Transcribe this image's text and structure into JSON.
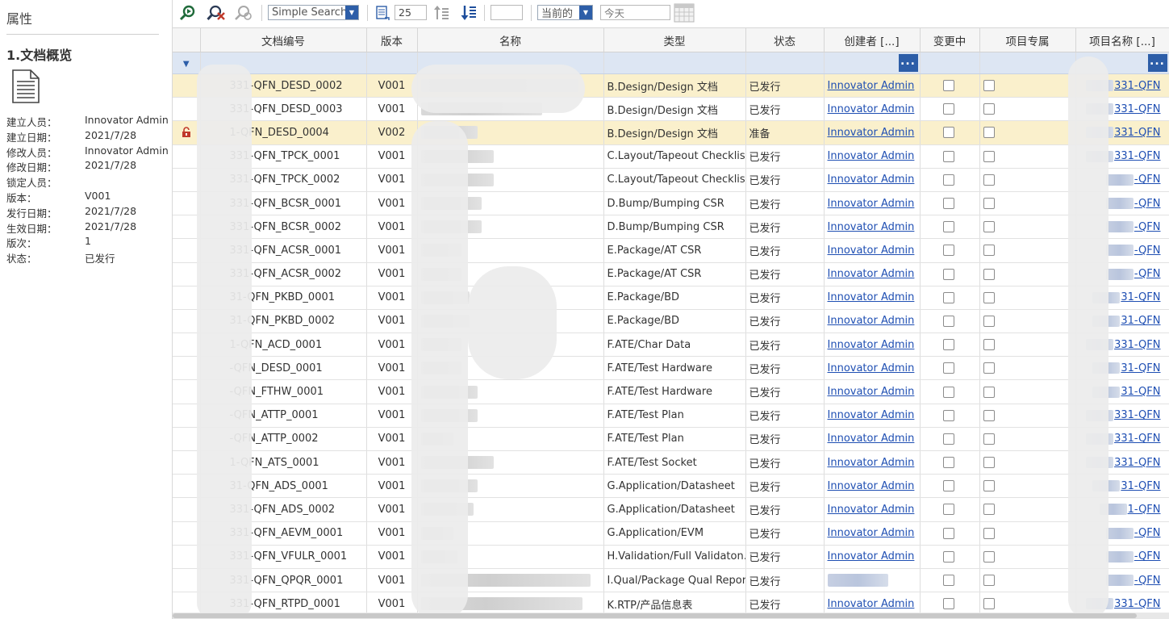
{
  "left_panel": {
    "title": "属性",
    "section_title": "1.文档概览",
    "doc_icon": "document-icon",
    "properties": [
      {
        "label": "建立人员：",
        "value": "Innovator Admin"
      },
      {
        "label": "建立日期：",
        "value": "2021/7/28"
      },
      {
        "label": "修改人员：",
        "value": "Innovator Admin"
      },
      {
        "label": "修改日期：",
        "value": "2021/7/28"
      },
      {
        "label": "锁定人员：",
        "value": ""
      },
      {
        "label": "版本：",
        "value": "V001"
      },
      {
        "label": "发行日期：",
        "value": "2021/7/28"
      },
      {
        "label": "生效日期：",
        "value": "2021/7/28"
      },
      {
        "label": "版次：",
        "value": "1"
      },
      {
        "label": "状态：",
        "value": "已发行"
      }
    ]
  },
  "toolbar": {
    "search_type": "Simple Search",
    "page_size": "25",
    "blank_input": "",
    "version_filter": "当前的",
    "date_input": "今天",
    "icons": [
      "run-search-icon",
      "clear-search-icon",
      "saved-search-icon",
      "page-size-icon",
      "sort-ascending-icon",
      "sort-descending-icon",
      "calendar-grid-icon"
    ]
  },
  "columns": [
    "",
    "文档编号",
    "版本",
    "名称",
    "类型",
    "状态",
    "创建者 [...]",
    "变更中",
    "项目专属",
    "项目名称 [...]"
  ],
  "filter_row": {
    "expand_icon": "expand-arrow-icon",
    "ellipsis": "..."
  },
  "rows": [
    {
      "num": "331-QFN_DESD_0002",
      "ver": "V001",
      "type": "B.Design/Design 文档",
      "status": "已发行",
      "creator": "Innovator Admin",
      "project": "331-QFN",
      "highlight": true,
      "locked": false
    },
    {
      "num": "331-QFN_DESD_0003",
      "ver": "V001",
      "type": "B.Design/Design 文档",
      "status": "已发行",
      "creator": "Innovator Admin",
      "project": "331-QFN",
      "highlight": false,
      "locked": false
    },
    {
      "num": "1-QFN_DESD_0004",
      "ver": "V002",
      "type": "B.Design/Design 文档",
      "status": "准备",
      "creator": "Innovator Admin",
      "project": "331-QFN",
      "highlight": true,
      "locked": true
    },
    {
      "num": "331-QFN_TPCK_0001",
      "ver": "V001",
      "type": "C.Layout/Tapeout Checklist",
      "status": "已发行",
      "creator": "Innovator Admin",
      "project": "331-QFN",
      "highlight": false,
      "locked": false
    },
    {
      "num": "331-QFN_TPCK_0002",
      "ver": "V001",
      "type": "C.Layout/Tapeout Checklist",
      "status": "已发行",
      "creator": "Innovator Admin",
      "project": "-QFN",
      "highlight": false,
      "locked": false
    },
    {
      "num": "331-QFN_BCSR_0001",
      "ver": "V001",
      "type": "D.Bump/Bumping CSR",
      "status": "已发行",
      "creator": "Innovator Admin",
      "project": "-QFN",
      "highlight": false,
      "locked": false
    },
    {
      "num": "331-QFN_BCSR_0002",
      "ver": "V001",
      "type": "D.Bump/Bumping CSR",
      "status": "已发行",
      "creator": "Innovator Admin",
      "project": "-QFN",
      "highlight": false,
      "locked": false
    },
    {
      "num": "331-QFN_ACSR_0001",
      "ver": "V001",
      "type": "E.Package/AT CSR",
      "status": "已发行",
      "creator": "Innovator Admin",
      "project": "-QFN",
      "highlight": false,
      "locked": false
    },
    {
      "num": "331-QFN_ACSR_0002",
      "ver": "V001",
      "type": "E.Package/AT CSR",
      "status": "已发行",
      "creator": "Innovator Admin",
      "project": "-QFN",
      "highlight": false,
      "locked": false
    },
    {
      "num": "31-QFN_PKBD_0001",
      "ver": "V001",
      "type": "E.Package/BD",
      "status": "已发行",
      "creator": "Innovator Admin",
      "project": "31-QFN",
      "highlight": false,
      "locked": false
    },
    {
      "num": "31-QFN_PKBD_0002",
      "ver": "V001",
      "type": "E.Package/BD",
      "status": "已发行",
      "creator": "Innovator Admin",
      "project": "31-QFN",
      "highlight": false,
      "locked": false
    },
    {
      "num": "1-QFN_ACD_0001",
      "ver": "V001",
      "type": "F.ATE/Char Data",
      "status": "已发行",
      "creator": "Innovator Admin",
      "project": "331-QFN",
      "highlight": false,
      "locked": false
    },
    {
      "num": "-QFN_DESD_0001",
      "ver": "V001",
      "type": "F.ATE/Test Hardware",
      "status": "已发行",
      "creator": "Innovator Admin",
      "project": "31-QFN",
      "highlight": false,
      "locked": false
    },
    {
      "num": "-QFN_FTHW_0001",
      "ver": "V001",
      "type": "F.ATE/Test Hardware",
      "status": "已发行",
      "creator": "Innovator Admin",
      "project": "31-QFN",
      "highlight": false,
      "locked": false
    },
    {
      "num": "-QFN_ATTP_0001",
      "ver": "V001",
      "type": "F.ATE/Test Plan",
      "status": "已发行",
      "creator": "Innovator Admin",
      "project": "331-QFN",
      "highlight": false,
      "locked": false
    },
    {
      "num": "-QFN_ATTP_0002",
      "ver": "V001",
      "type": "F.ATE/Test Plan",
      "status": "已发行",
      "creator": "Innovator Admin",
      "project": "331-QFN",
      "highlight": false,
      "locked": false
    },
    {
      "num": "1-QFN_ATS_0001",
      "ver": "V001",
      "type": "F.ATE/Test Socket",
      "status": "已发行",
      "creator": "Innovator Admin",
      "project": "331-QFN",
      "highlight": false,
      "locked": false
    },
    {
      "num": "31-QFN_ADS_0001",
      "ver": "V001",
      "type": "G.Application/Datasheet",
      "status": "已发行",
      "creator": "Innovator Admin",
      "project": "31-QFN",
      "highlight": false,
      "locked": false
    },
    {
      "num": "331-QFN_ADS_0002",
      "ver": "V001",
      "type": "G.Application/Datasheet",
      "status": "已发行",
      "creator": "Innovator Admin",
      "project": "1-QFN",
      "highlight": false,
      "locked": false
    },
    {
      "num": "331-QFN_AEVM_0001",
      "ver": "V001",
      "type": "G.Application/EVM",
      "status": "已发行",
      "creator": "Innovator Admin",
      "project": "-QFN",
      "highlight": false,
      "locked": false
    },
    {
      "num": "331-QFN_VFULR_0001",
      "ver": "V001",
      "type": "H.Validation/Full Validaton...",
      "status": "已发行",
      "creator": "Innovator Admin",
      "project": "-QFN",
      "highlight": false,
      "locked": false
    },
    {
      "num": "331-QFN_QPQR_0001",
      "ver": "V001",
      "type": "I.Qual/Package Qual Report",
      "status": "已发行",
      "creator": "",
      "project": "-QFN",
      "highlight": false,
      "locked": false
    },
    {
      "num": "331-QFN_RTPD_0001",
      "ver": "V001",
      "type": "K.RTP/产品信息表",
      "status": "已发行",
      "creator": "Innovator Admin",
      "project": "331-QFN",
      "highlight": false,
      "locked": false
    }
  ]
}
